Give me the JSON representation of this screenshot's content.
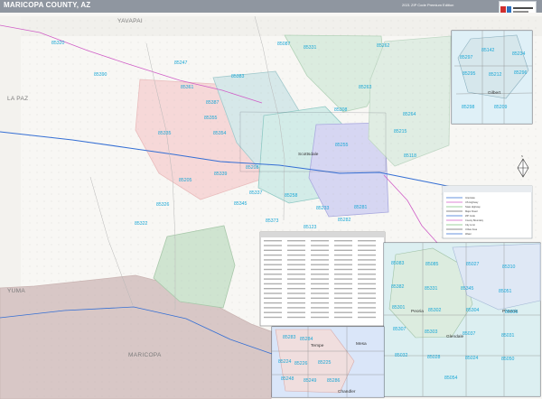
{
  "header": {
    "title": "MARICOPA COUNTY, AZ",
    "edition": "2021 ZIP Code Premium Edition"
  },
  "counties": {
    "yavapai": "YAVAPAI",
    "la_paz": "LA PAZ",
    "yuma": "YUMA",
    "maricopa": "MARICOPA"
  },
  "places": {
    "scottsdale": "Scottsdale",
    "gilbert": "Gilbert",
    "tempe": "Tempe",
    "mesa": "Mesa",
    "chandler": "Chandler",
    "peoria": "Peoria",
    "glendale": "Glendale",
    "phoenix": "Phoenix"
  },
  "zip_labels": [
    "85320",
    "85390",
    "85087",
    "85331",
    "85262",
    "85247",
    "85361",
    "85383",
    "85387",
    "85263",
    "85355",
    "85354",
    "85335",
    "85308",
    "85255",
    "85264",
    "85215",
    "85118",
    "85322",
    "85326",
    "85339",
    "85337",
    "85258",
    "85233",
    "85282",
    "85281",
    "85123",
    "85345",
    "85373",
    "85205",
    "85208"
  ],
  "inset_zip_labels": [
    "85297",
    "85142",
    "85234",
    "85295",
    "85212",
    "85296",
    "85298",
    "85209",
    "85283",
    "85284",
    "85224",
    "85226",
    "85225",
    "85248",
    "85249",
    "85286",
    "85083",
    "85085",
    "85027",
    "85310",
    "85382",
    "85331",
    "85345",
    "85051",
    "85301",
    "85302",
    "85304",
    "85305",
    "85307",
    "85303",
    "85037",
    "85031",
    "85032",
    "85028",
    "85024",
    "85050",
    "85054"
  ],
  "legend_rows": [
    "Interstate",
    "US Highway",
    "State Highway",
    "Major Road",
    "ZIP Code",
    "County Boundary",
    "City Limit",
    "Urban Area",
    "Water"
  ]
}
